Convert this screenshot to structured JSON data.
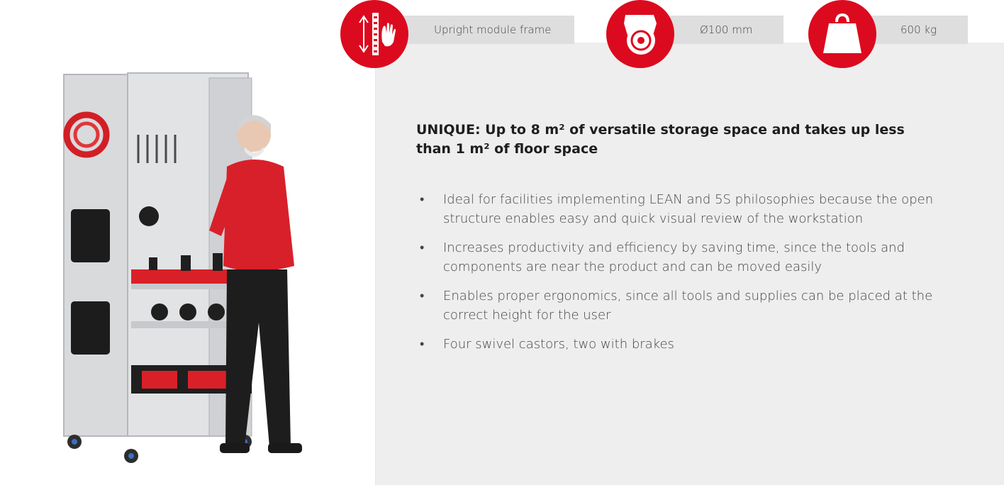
{
  "specs": [
    {
      "label": "Upright module frame",
      "icon": "upright-frame-hand-icon"
    },
    {
      "label": "Ø100 mm",
      "icon": "castor-wheel-icon"
    },
    {
      "label": "600 kg",
      "icon": "weight-icon"
    }
  ],
  "headline": "UNIQUE: Up to 8 m² of versatile storage space and takes up less than 1 m² of floor space",
  "bullets": [
    "Ideal for facilities implementing LEAN and 5S philosophies because the open structure enables easy and quick visual review of the workstation",
    "Increases productivity and efficiency by saving time, since the tools and components are near the product and can be moved easily",
    "Enables proper ergonomics, since all tools and supplies can be placed at the correct height for the user",
    "Four swivel castors, two with brakes"
  ],
  "bullet_symbol": "•",
  "colors": {
    "accent": "#dc0a1e",
    "panel": "#eeeeee",
    "bar": "#dedede",
    "text": "#444444"
  }
}
